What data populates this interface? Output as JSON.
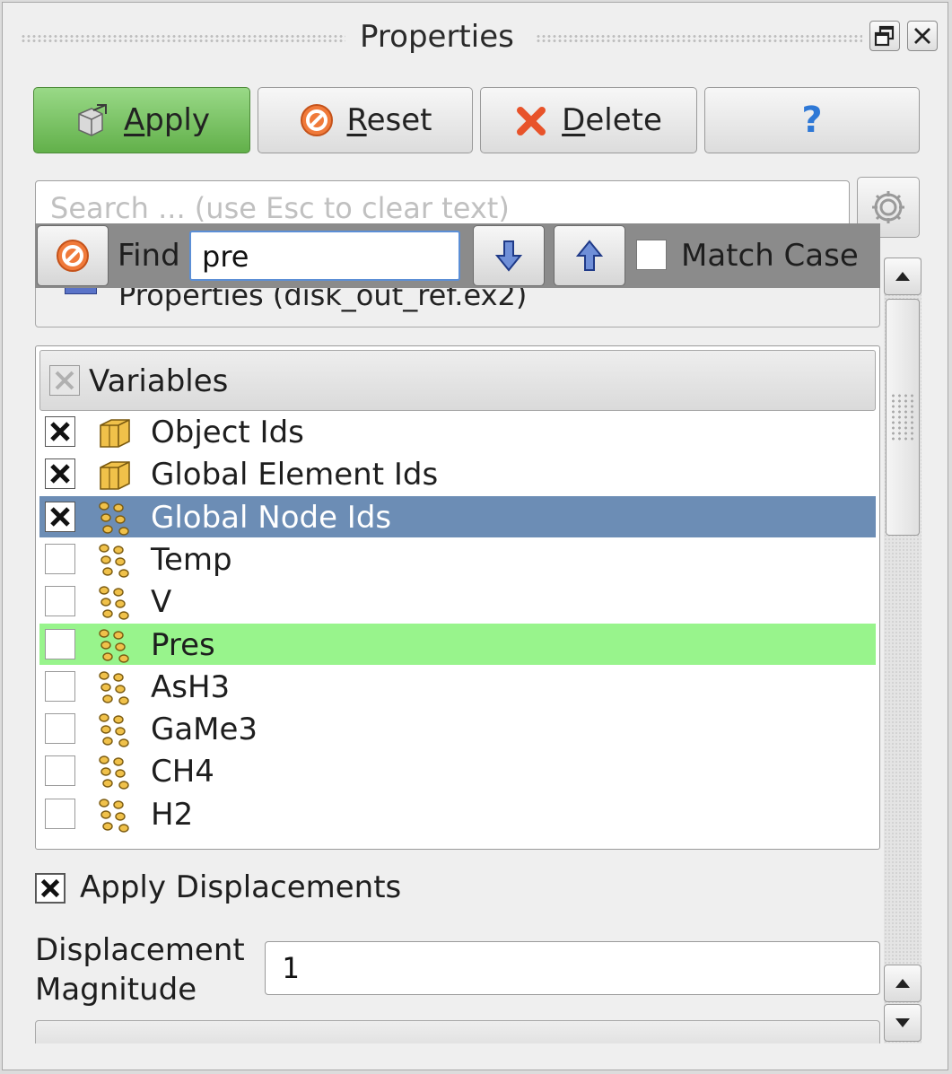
{
  "title": "Properties",
  "buttons": {
    "apply": {
      "label": "Apply",
      "mnemonic": "A",
      "rest": "pply"
    },
    "reset": {
      "label": "Reset",
      "mnemonic": "R",
      "rest": "eset"
    },
    "delete": {
      "label": "Delete",
      "mnemonic": "D",
      "rest": "elete"
    },
    "help": {
      "label": "?"
    }
  },
  "search": {
    "placeholder": "Search ... (use Esc to clear text)",
    "value": ""
  },
  "properties_group": {
    "label": "Properties (disk_out_ref.ex2)"
  },
  "find_bar": {
    "label": "Find",
    "value": "pre",
    "match_case_label": "Match Case",
    "match_case_checked": false
  },
  "variables": {
    "header": "Variables",
    "items": [
      {
        "label": "Object Ids",
        "checked": true,
        "icon": "cell-data-icon",
        "state": "normal"
      },
      {
        "label": "Global Element Ids",
        "checked": true,
        "icon": "cell-data-icon",
        "state": "normal"
      },
      {
        "label": "Global Node Ids",
        "checked": true,
        "icon": "point-data-icon",
        "state": "selected"
      },
      {
        "label": "Temp",
        "checked": false,
        "icon": "point-data-icon",
        "state": "normal"
      },
      {
        "label": "V",
        "checked": false,
        "icon": "point-data-icon",
        "state": "normal"
      },
      {
        "label": "Pres",
        "checked": false,
        "icon": "point-data-icon",
        "state": "found"
      },
      {
        "label": "AsH3",
        "checked": false,
        "icon": "point-data-icon",
        "state": "normal"
      },
      {
        "label": "GaMe3",
        "checked": false,
        "icon": "point-data-icon",
        "state": "normal"
      },
      {
        "label": "CH4",
        "checked": false,
        "icon": "point-data-icon",
        "state": "normal"
      },
      {
        "label": "H2",
        "checked": false,
        "icon": "point-data-icon",
        "state": "normal"
      }
    ]
  },
  "apply_displacements": {
    "label": "Apply Displacements",
    "checked": true
  },
  "displacement_magnitude": {
    "label_line1": "Displacement",
    "label_line2": "Magnitude",
    "value": "1"
  },
  "colors": {
    "apply_green": "#62b04a",
    "selected_row": "#6c8db5",
    "found_row": "#98f48c",
    "find_bar_bg": "#8b8b8b"
  }
}
